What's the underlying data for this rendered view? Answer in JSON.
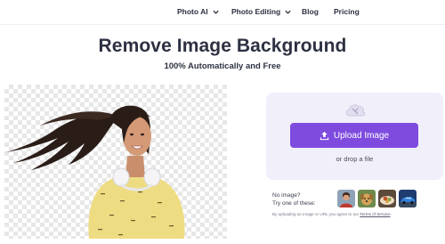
{
  "nav": {
    "items": [
      {
        "label": "Photo AI",
        "has_dropdown": true
      },
      {
        "label": "Photo Editing",
        "has_dropdown": true
      },
      {
        "label": "Blog",
        "has_dropdown": false
      },
      {
        "label": "Pricing",
        "has_dropdown": false
      }
    ]
  },
  "hero": {
    "title": "Remove Image Background",
    "subtitle": "100% Automatically and Free"
  },
  "upload": {
    "button_label": "Upload Image",
    "drop_text": "or drop a file",
    "icon": "cloud-upload-icon",
    "accent_color": "#7e4bde",
    "card_color": "#f1eff9"
  },
  "samples": {
    "no_image_line1": "No image?",
    "no_image_line2": "Try one of these:",
    "thumbnails": [
      "person-sample",
      "dog-sample",
      "food-sample",
      "car-sample"
    ]
  },
  "terms": {
    "prefix": "By uploading an image or URL you agree to our",
    "link": "Terms of Service",
    "suffix": "."
  }
}
